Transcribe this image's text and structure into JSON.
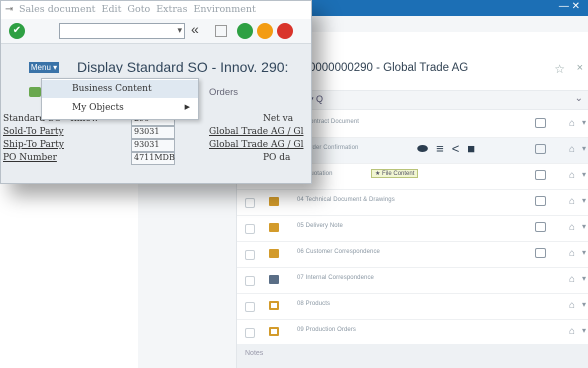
{
  "back": {
    "title": "0000000290 - Global Trade AG",
    "filter": "▾ Q",
    "footer_text": "Notes",
    "row_actions": [
      "⬬",
      "≡",
      "<",
      "■"
    ],
    "tag": "★ File Content",
    "rows": [
      {
        "name": "01 Contract Document",
        "folder": "normal",
        "chat": true
      },
      {
        "name": "02 Order Confirmation",
        "folder": "normal",
        "chat": true,
        "selected": true
      },
      {
        "name": "03 Quotation",
        "folder": "normal",
        "chat": true,
        "tag": true
      },
      {
        "name": "04 Technical Document & Drawings",
        "folder": "normal",
        "chat": true
      },
      {
        "name": "05 Delivery Note",
        "folder": "normal",
        "chat": true
      },
      {
        "name": "06 Customer Correspondence",
        "folder": "normal",
        "chat": true
      },
      {
        "name": "07 Internal Correspondence",
        "folder": "slate",
        "chat": false
      },
      {
        "name": "08 Products",
        "folder": "outline",
        "chat": false
      },
      {
        "name": "09 Production Orders",
        "folder": "outline",
        "chat": false
      }
    ]
  },
  "gui": {
    "menu": [
      "⇥",
      "Sales document",
      "Edit",
      "Goto",
      "Extras",
      "Environment"
    ],
    "menu_button": "Menu ▾",
    "title": "Display Standard SO - Innov. 290:",
    "orders_label": "Orders",
    "context_menu": [
      {
        "label": "Business Content",
        "highlighted": true
      },
      {
        "label": "My Objects",
        "submenu": true
      }
    ],
    "form": [
      {
        "label": "Standard SO - Innov.",
        "value": "290",
        "underline": false,
        "desc": "",
        "net": "Net va"
      },
      {
        "label": "Sold-To Party",
        "value": "93031",
        "underline": true,
        "desc": "Global Trade AG / Gl",
        "net": ""
      },
      {
        "label": "Ship-To Party",
        "value": "93031",
        "underline": true,
        "desc": "Global Trade AG / Gl",
        "net": ""
      },
      {
        "label": "PO Number",
        "value": "4711MDB",
        "underline": true,
        "desc": "",
        "net": "PO da"
      }
    ]
  }
}
